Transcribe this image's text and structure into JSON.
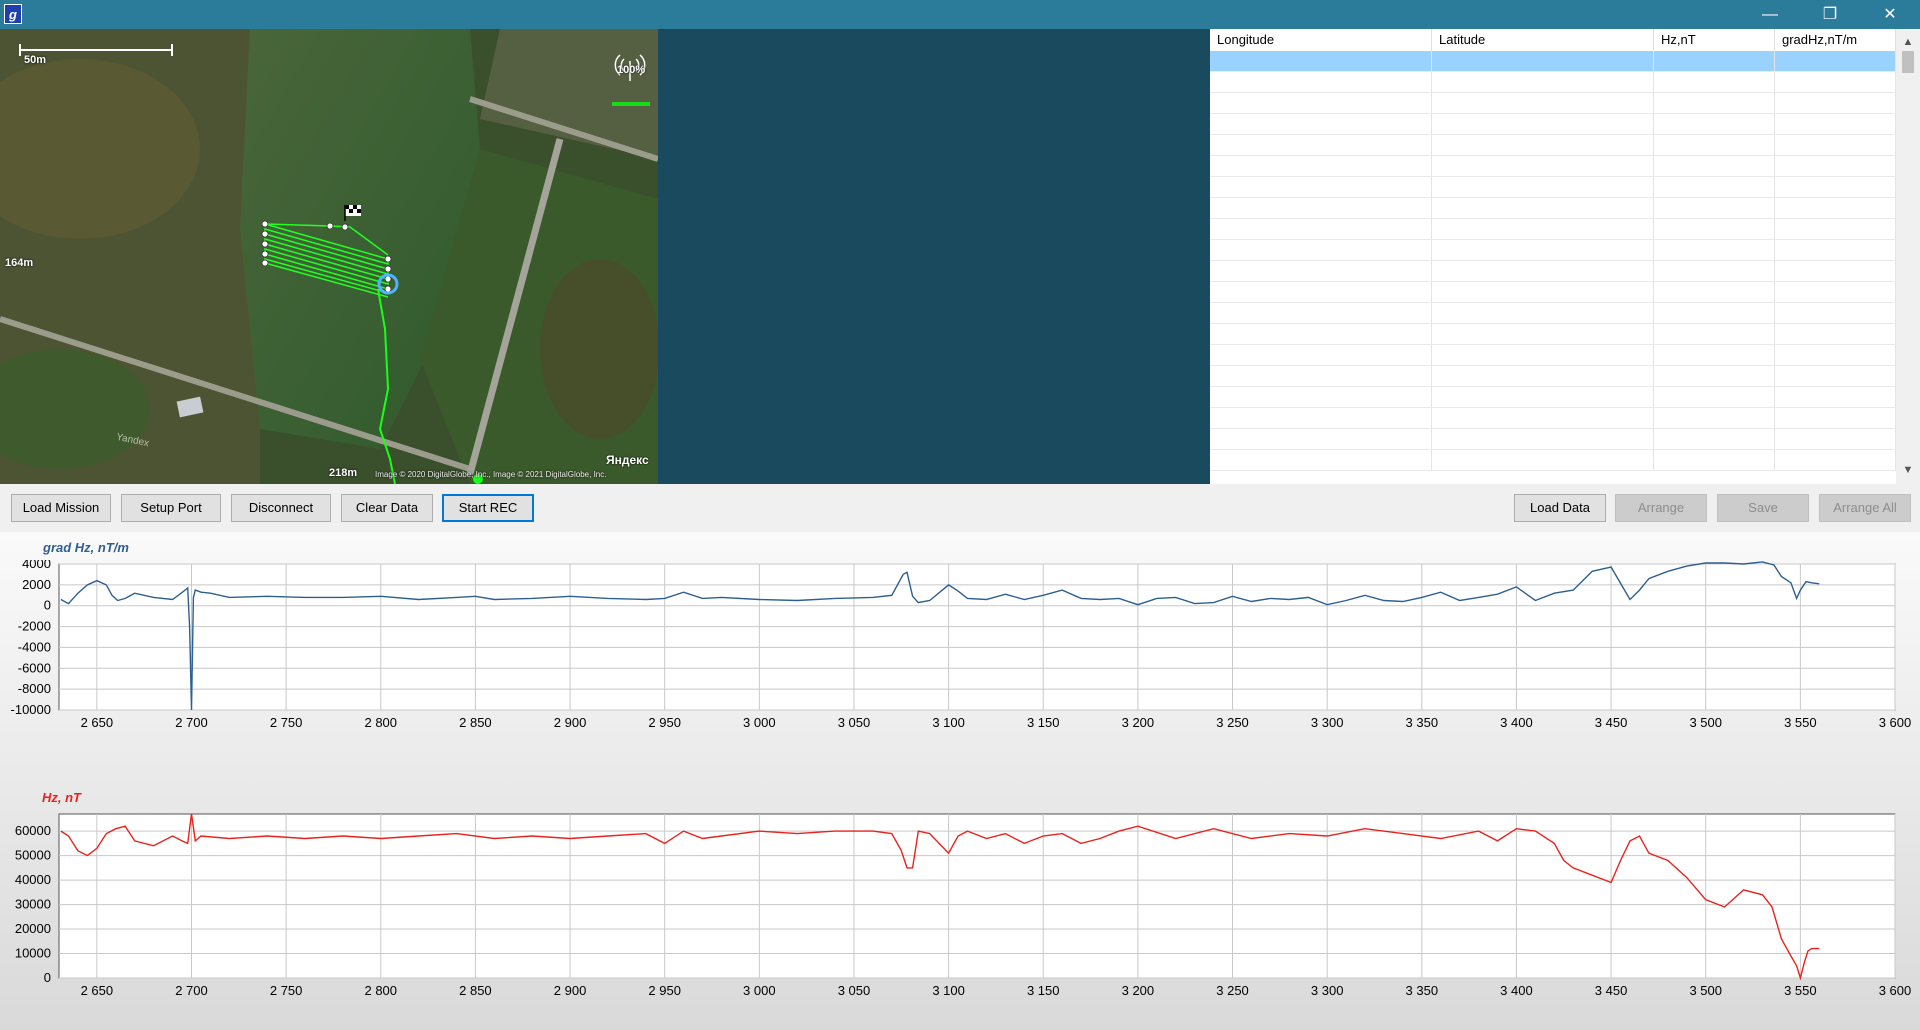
{
  "window": {
    "icon_letter": "g",
    "controls": {
      "minimize": "—",
      "restore": "❐",
      "close": "✕"
    }
  },
  "map": {
    "scale_label": "50m",
    "signal_percent": "100%",
    "distance_left": "164m",
    "distance_bottom": "218m",
    "watermark": "Yandex",
    "attribution": "Image © 2020 DigitalGlobe, Inc., Image © 2021 DigitalGlobe, Inc.",
    "brand": "Яндекс"
  },
  "grid": {
    "columns": [
      "Longitude",
      "Latitude",
      "Hz,nT",
      "gradHz,nT/m"
    ],
    "rows": []
  },
  "toolbar": {
    "load_mission": "Load Mission",
    "setup_port": "Setup Port",
    "disconnect": "Disconnect",
    "clear_data": "Clear Data",
    "start_rec": "Start REC",
    "load_data": "Load Data",
    "arrange": "Arrange",
    "save": "Save",
    "arrange_all": "Arrange All"
  },
  "colors": {
    "grad_series": "#2e5f91",
    "hz_series": "#e8231e",
    "title_bar": "#2b7c9b",
    "dark_panel": "#1a4a5e"
  },
  "chart_data": [
    {
      "type": "line",
      "title": "grad Hz, nT/m",
      "xlim": [
        2630,
        3600
      ],
      "ylim": [
        -10000,
        4000
      ],
      "x_ticks": [
        "2 650",
        "2 700",
        "2 750",
        "2 800",
        "2 850",
        "2 900",
        "2 950",
        "3 000",
        "3 050",
        "3 100",
        "3 150",
        "3 200",
        "3 250",
        "3 300",
        "3 350",
        "3 400",
        "3 450",
        "3 500",
        "3 550",
        "3 600"
      ],
      "y_ticks": [
        "4000",
        "2000",
        "0",
        "-2000",
        "-4000",
        "-6000",
        "-8000",
        "-10000"
      ],
      "series": [
        {
          "x": [
            2631,
            2635,
            2640,
            2645,
            2650,
            2655,
            2658,
            2661,
            2665,
            2670,
            2680,
            2690,
            2696,
            2698,
            2699,
            2700,
            2701,
            2702,
            2705,
            2710,
            2720,
            2740,
            2760,
            2780,
            2800,
            2820,
            2840,
            2850,
            2860,
            2880,
            2900,
            2920,
            2940,
            2950,
            2960,
            2970,
            2980,
            3000,
            3020,
            3040,
            3060,
            3070,
            3076,
            3078,
            3081,
            3084,
            3090,
            3100,
            3105,
            3110,
            3120,
            3130,
            3140,
            3150,
            3160,
            3170,
            3180,
            3190,
            3200,
            3210,
            3220,
            3230,
            3240,
            3250,
            3260,
            3270,
            3280,
            3290,
            3300,
            3310,
            3320,
            3330,
            3340,
            3350,
            3360,
            3370,
            3380,
            3390,
            3400,
            3410,
            3420,
            3430,
            3435,
            3440,
            3450,
            3460,
            3465,
            3470,
            3480,
            3490,
            3500,
            3510,
            3520,
            3530,
            3536,
            3540,
            3545,
            3548,
            3550,
            3553,
            3556,
            3560
          ],
          "y": [
            600,
            200,
            1200,
            2000,
            2400,
            2000,
            1000,
            500,
            700,
            1200,
            800,
            600,
            1400,
            1700,
            -2000,
            -10000,
            800,
            1500,
            1300,
            1200,
            800,
            900,
            800,
            800,
            900,
            600,
            800,
            900,
            600,
            700,
            900,
            700,
            600,
            700,
            1300,
            700,
            800,
            600,
            500,
            700,
            800,
            1000,
            3000,
            3200,
            900,
            300,
            500,
            2000,
            1400,
            700,
            600,
            1100,
            600,
            1000,
            1500,
            700,
            600,
            700,
            100,
            700,
            800,
            200,
            300,
            900,
            400,
            700,
            600,
            800,
            100,
            500,
            1000,
            500,
            400,
            800,
            1300,
            500,
            800,
            1100,
            1800,
            500,
            1200,
            1500,
            2400,
            3300,
            3700,
            600,
            1500,
            2600,
            3300,
            3800,
            4100,
            4100,
            4000,
            4200,
            3900,
            2800,
            2200,
            700,
            1500,
            2300,
            2200,
            2100
          ]
        }
      ]
    },
    {
      "type": "line",
      "title": "Hz, nT",
      "xlim": [
        2630,
        3600
      ],
      "ylim": [
        0,
        67000
      ],
      "x_ticks": [
        "2 650",
        "2 700",
        "2 750",
        "2 800",
        "2 850",
        "2 900",
        "2 950",
        "3 000",
        "3 050",
        "3 100",
        "3 150",
        "3 200",
        "3 250",
        "3 300",
        "3 350",
        "3 400",
        "3 450",
        "3 500",
        "3 550",
        "3 600"
      ],
      "y_ticks": [
        "60000",
        "50000",
        "40000",
        "30000",
        "20000",
        "10000",
        "0"
      ],
      "series": [
        {
          "x": [
            2631,
            2635,
            2640,
            2645,
            2650,
            2655,
            2660,
            2665,
            2670,
            2680,
            2690,
            2695,
            2698,
            2700,
            2702,
            2705,
            2720,
            2740,
            2760,
            2780,
            2800,
            2820,
            2840,
            2860,
            2880,
            2900,
            2920,
            2940,
            2950,
            2960,
            2970,
            2980,
            3000,
            3020,
            3040,
            3060,
            3070,
            3075,
            3078,
            3081,
            3084,
            3090,
            3100,
            3105,
            3110,
            3120,
            3130,
            3140,
            3150,
            3160,
            3170,
            3180,
            3190,
            3200,
            3220,
            3240,
            3260,
            3280,
            3300,
            3320,
            3340,
            3360,
            3380,
            3390,
            3400,
            3410,
            3420,
            3425,
            3430,
            3440,
            3450,
            3455,
            3460,
            3465,
            3470,
            3480,
            3490,
            3500,
            3510,
            3520,
            3530,
            3535,
            3540,
            3545,
            3548,
            3550,
            3552,
            3554,
            3556,
            3560
          ],
          "y": [
            60000,
            58000,
            52000,
            50000,
            53000,
            59000,
            61000,
            62000,
            56000,
            54000,
            58000,
            56000,
            55000,
            67000,
            56000,
            58000,
            57000,
            58000,
            57000,
            58000,
            57000,
            58000,
            59000,
            57000,
            58000,
            57000,
            58000,
            59000,
            55000,
            60000,
            57000,
            58000,
            60000,
            59000,
            60000,
            60000,
            59000,
            52000,
            45000,
            45000,
            60000,
            59000,
            51000,
            58000,
            60000,
            57000,
            59000,
            55000,
            58000,
            59000,
            55000,
            57000,
            60000,
            62000,
            57000,
            61000,
            57000,
            59000,
            58000,
            61000,
            59000,
            57000,
            60000,
            56000,
            61000,
            60000,
            55000,
            48000,
            45000,
            42000,
            39000,
            48000,
            56000,
            58000,
            51000,
            48000,
            41000,
            32000,
            29000,
            36000,
            34000,
            29000,
            16000,
            9000,
            5000,
            0,
            6000,
            11000,
            12000,
            12000
          ]
        }
      ]
    }
  ]
}
